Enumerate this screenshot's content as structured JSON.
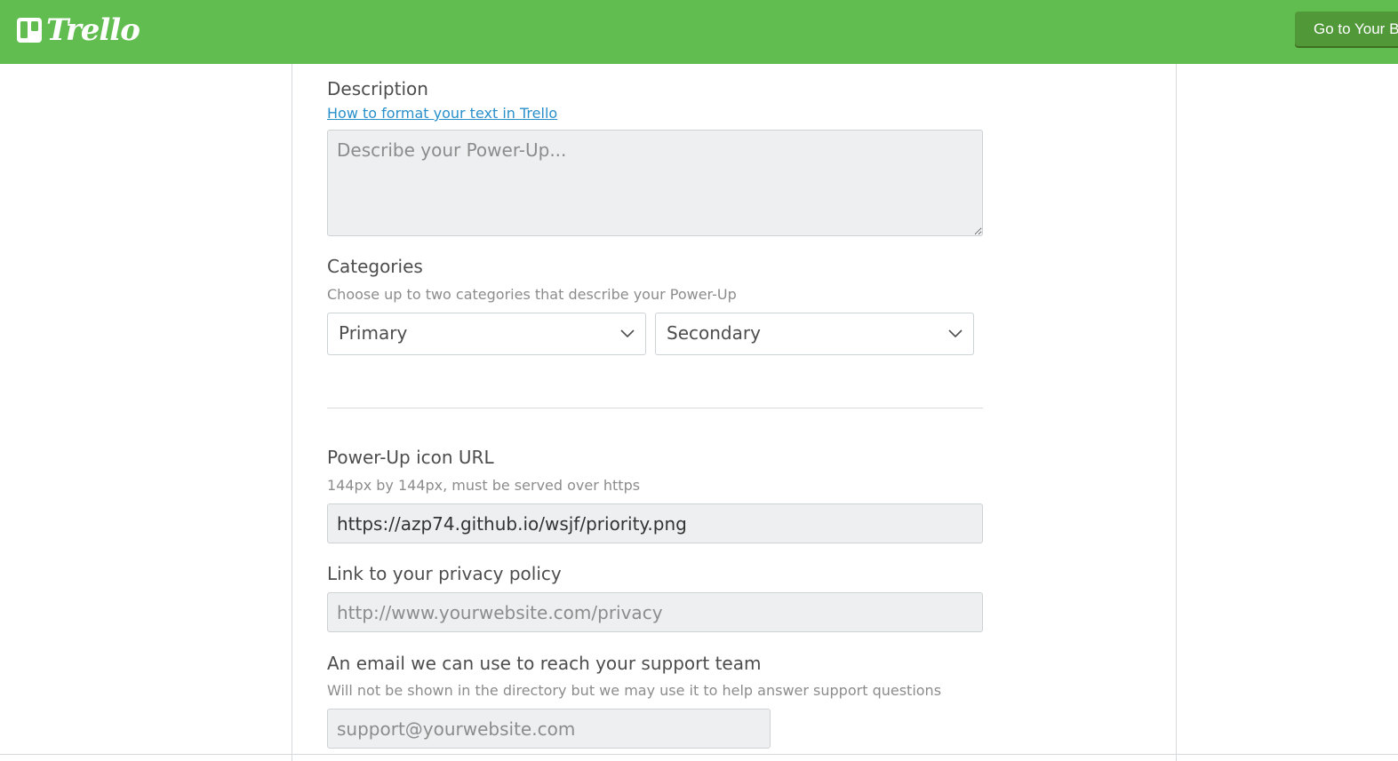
{
  "header": {
    "brand": "Trello",
    "go_button_label": "Go to Your Boards",
    "bar_color": "#61bd4f",
    "button_color": "#519839"
  },
  "form": {
    "description": {
      "label": "Description",
      "format_link": "How to format your text in Trello",
      "placeholder": "Describe your Power-Up..."
    },
    "categories": {
      "label": "Categories",
      "hint": "Choose up to two categories that describe your Power-Up",
      "primary_value": "Primary",
      "secondary_value": "Secondary"
    },
    "icon_url": {
      "label": "Power-Up icon URL",
      "hint": "144px by 144px, must be served over https",
      "value": "https://azp74.github.io/wsjf/priority.png"
    },
    "privacy": {
      "label": "Link to your privacy policy",
      "placeholder": "http://www.yourwebsite.com/privacy"
    },
    "support_email": {
      "label": "An email we can use to reach your support team",
      "hint": "Will not be shown in the directory but we may use it to help answer support questions",
      "placeholder": "support@yourwebsite.com"
    }
  }
}
